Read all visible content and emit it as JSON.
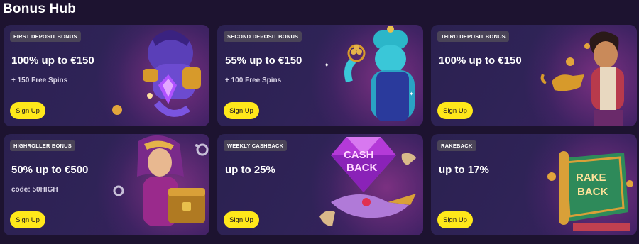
{
  "page": {
    "title": "Bonus Hub"
  },
  "cards": [
    {
      "badge": "FIRST DEPOSIT BONUS",
      "headline": "100% up to €150",
      "subline": "+ 150 Free Spins",
      "button": "Sign Up"
    },
    {
      "badge": "SECOND DEPOSIT BONUS",
      "headline": "55% up to €150",
      "subline": "+ 100 Free Spins",
      "button": "Sign Up"
    },
    {
      "badge": "THIRD DEPOSIT BONUS",
      "headline": "100% up to €150",
      "subline": "",
      "button": "Sign Up"
    },
    {
      "badge": "HIGHROLLER BONUS",
      "headline": "50% up to €500",
      "subline": "code: 50HIGH",
      "button": "Sign Up"
    },
    {
      "badge": "WEEKLY CASHBACK",
      "headline": "up to 25%",
      "subline": "",
      "button": "Sign Up"
    },
    {
      "badge": "RAKEBACK",
      "headline": "up to 17%",
      "subline": "",
      "button": "Sign Up"
    }
  ],
  "art": {
    "cashback_text": [
      "CASH",
      "BACK"
    ],
    "rakeback_text": [
      "RAKE",
      "BACK"
    ]
  },
  "colors": {
    "background": "#1d1330",
    "card": "#2e2255",
    "button": "#ffe81a",
    "badge": "#4a4458"
  }
}
